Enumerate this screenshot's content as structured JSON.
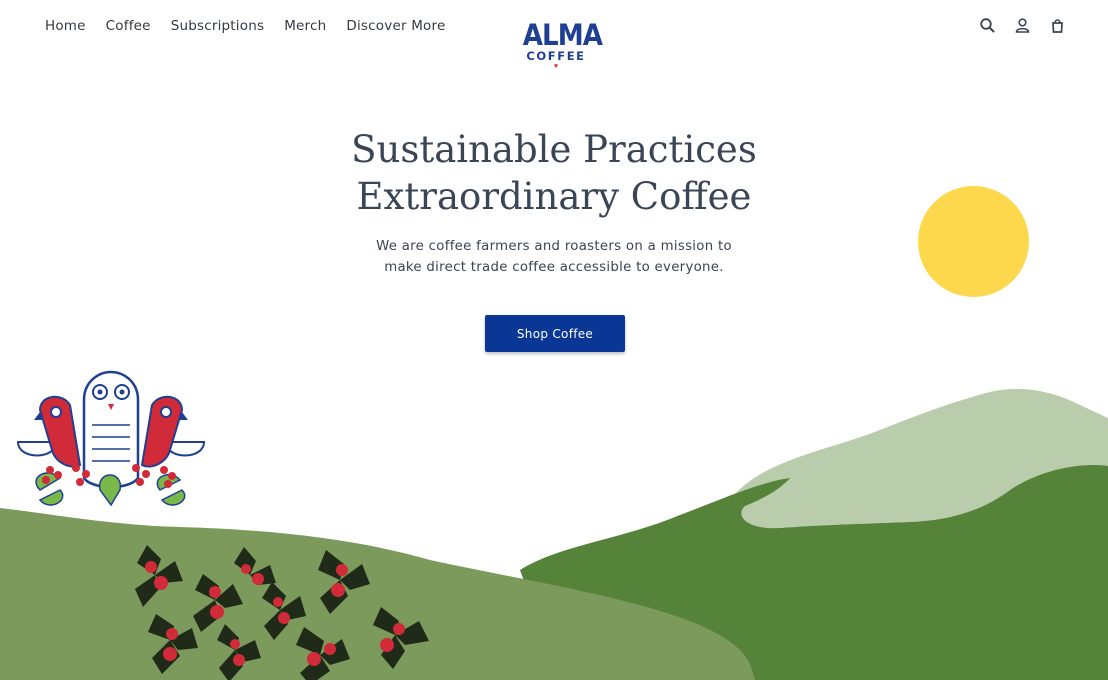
{
  "nav": {
    "items": [
      "Home",
      "Coffee",
      "Subscriptions",
      "Merch",
      "Discover More"
    ]
  },
  "logo": {
    "line1": "ALMA",
    "line2": "COFFEE"
  },
  "header_icons": [
    "search-icon",
    "account-icon",
    "cart-icon"
  ],
  "hero": {
    "title_line1": "Sustainable Practices",
    "title_line2": "Extraordinary Coffee",
    "subtitle_line1": "We are coffee farmers and roasters on a mission to",
    "subtitle_line2": "make direct trade coffee accessible to everyone.",
    "cta_label": "Shop Coffee"
  },
  "colors": {
    "brand_blue": "#0a3796",
    "logo_blue": "#1f3f91",
    "sun_yellow": "#fdd84c",
    "hill_light": "#7b9a5c",
    "hill_dark": "#56833a",
    "mountain_pale": "#b9ccac",
    "berry_red": "#d12a38",
    "leaf_dark": "#1f2a18"
  }
}
